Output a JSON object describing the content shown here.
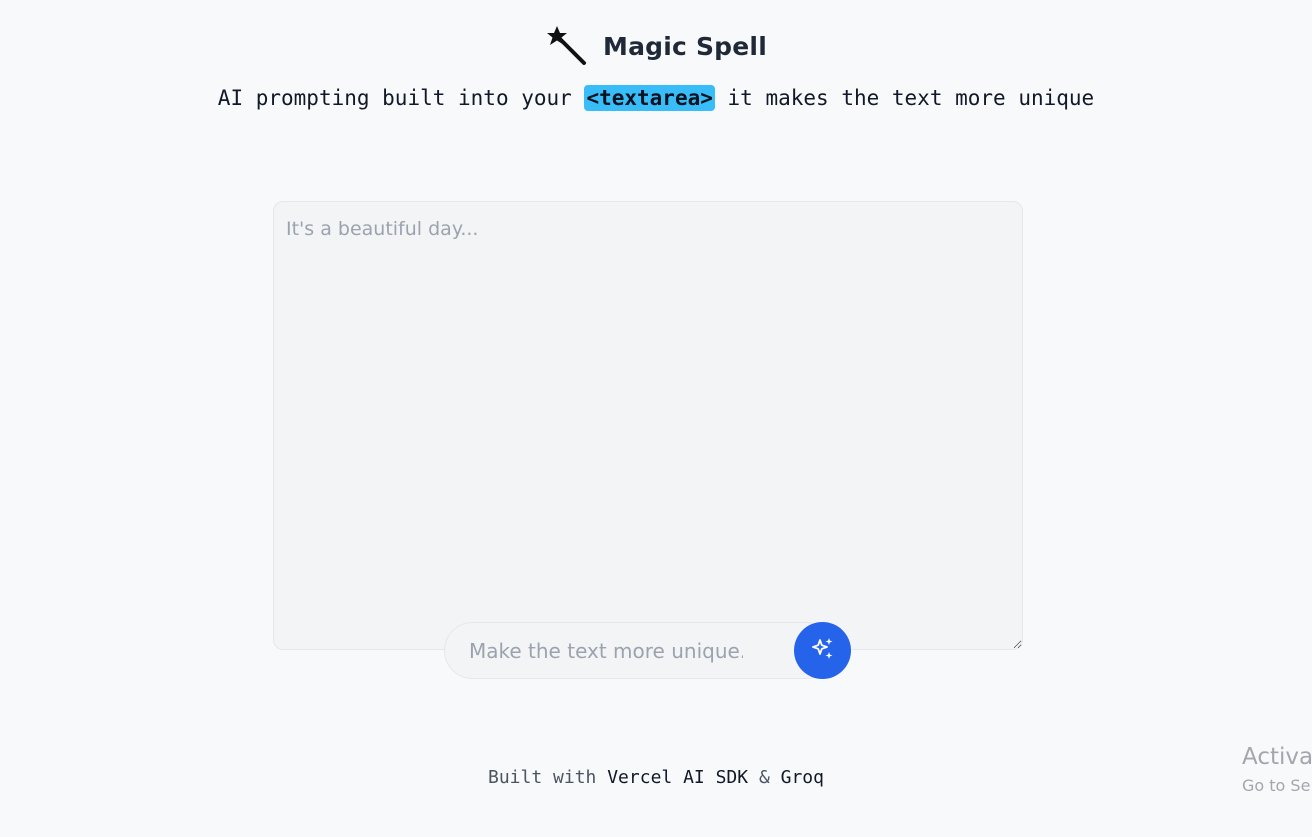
{
  "app": {
    "title": "Magic Spell",
    "icon": "magic-wand-icon"
  },
  "tagline": {
    "before": "AI prompting built into your ",
    "code": "<textarea>",
    "after": " it makes the text more unique",
    "code_highlight_color": "#38bdf8"
  },
  "editor": {
    "value": "",
    "placeholder": "It's a beautiful day..."
  },
  "prompt": {
    "value": "",
    "placeholder": "Make the text more unique...",
    "submit_icon": "sparkles-icon",
    "accent_color": "#2563eb"
  },
  "footer": {
    "prefix": "Built with ",
    "link1": "Vercel AI SDK",
    "separator": " & ",
    "link2": "Groq"
  },
  "watermark": {
    "line1": "Activat",
    "line2": "Go to Se"
  }
}
